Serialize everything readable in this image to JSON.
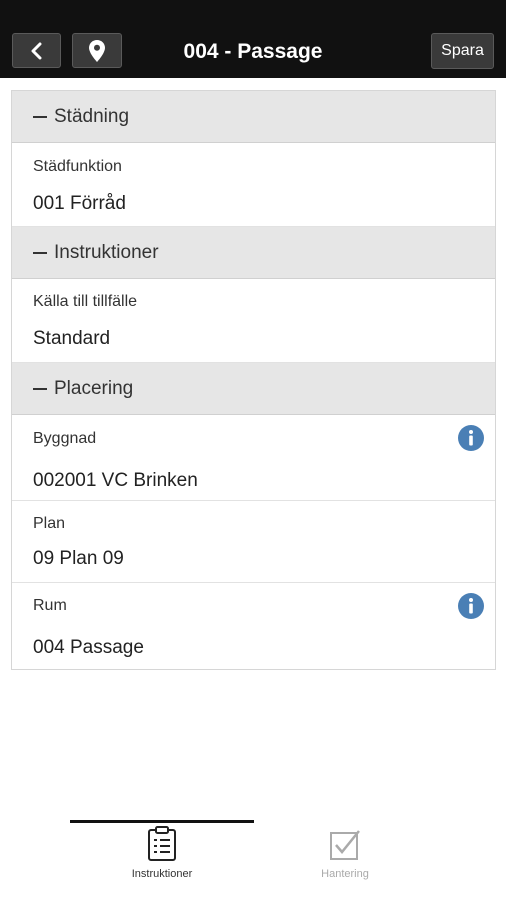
{
  "header": {
    "title": "004 - Passage",
    "save_label": "Spara",
    "back_icon": "chevron-left-icon",
    "location_icon": "map-pin-icon"
  },
  "sections": [
    {
      "title": "Städning",
      "fields": [
        {
          "label": "Städfunktion",
          "value": "001 Förråd",
          "info": false
        }
      ]
    },
    {
      "title": "Instruktioner",
      "fields": [
        {
          "label": "Källa till tillfälle",
          "value": "Standard",
          "info": false
        }
      ]
    },
    {
      "title": "Placering",
      "fields": [
        {
          "label": "Byggnad",
          "value": "002001 VC Brinken",
          "info": true
        },
        {
          "label": "Plan",
          "value": "09 Plan 09",
          "info": false
        },
        {
          "label": "Rum",
          "value": "004 Passage",
          "info": true
        }
      ]
    }
  ],
  "tabs": [
    {
      "label": "Instruktioner",
      "icon": "clipboard-icon",
      "active": true
    },
    {
      "label": "Hantering",
      "icon": "checkbox-icon",
      "active": false
    }
  ],
  "colors": {
    "topbar": "#111111",
    "info": "#4a7fb5",
    "section_header_bg": "#e6e6e6",
    "inactive_tab": "#aaaaaa"
  }
}
